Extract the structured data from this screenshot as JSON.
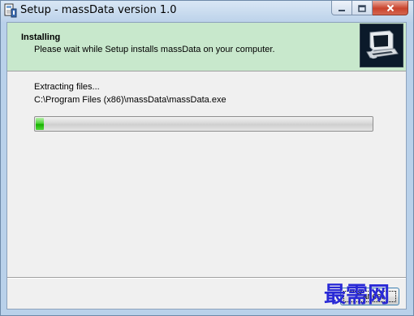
{
  "window": {
    "title": "Setup - massData version 1.0"
  },
  "header": {
    "title": "Installing",
    "subtitle": "Please wait while Setup installs massData on your computer."
  },
  "status": {
    "line1": "Extracting files...",
    "line2": "C:\\Program Files (x86)\\massData\\massData.exe"
  },
  "progress": {
    "percent": 2.5
  },
  "footer": {
    "button_label": "Cancel"
  },
  "watermark": {
    "text": "最需网"
  },
  "colors": {
    "header_bg": "#c8e8cc",
    "progress_fill": "#17b200",
    "watermark": "#2a2ad6"
  },
  "icons": {
    "app": "setup-app-icon",
    "logo": "installer-box-icon",
    "minimize": "minimize-icon",
    "maximize": "maximize-icon",
    "close": "close-icon"
  }
}
